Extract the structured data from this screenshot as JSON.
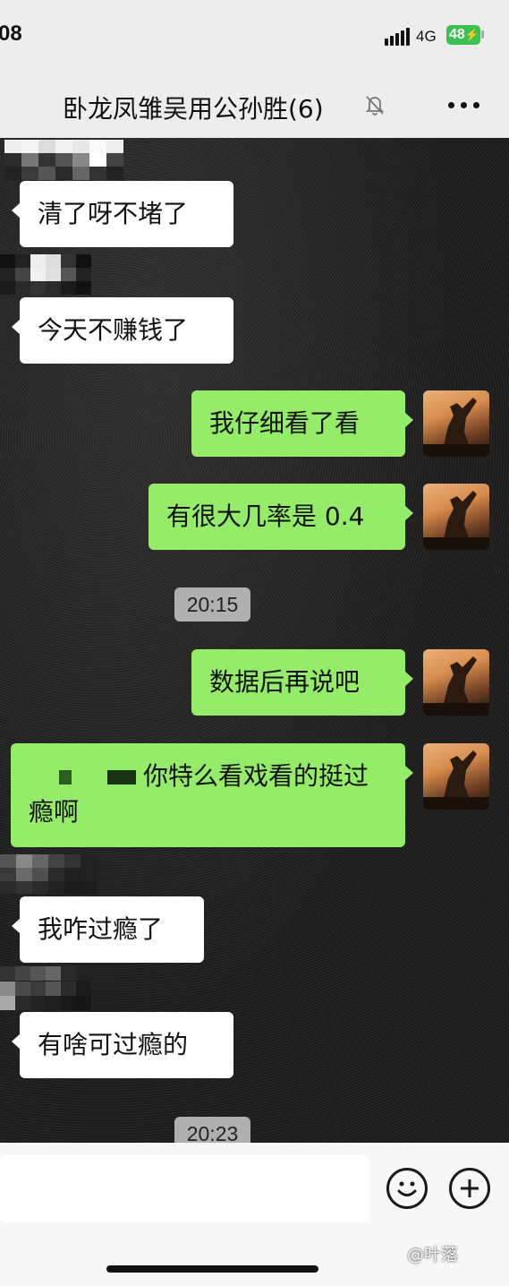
{
  "status_bar": {
    "time": "08",
    "network": "4G",
    "battery": "48"
  },
  "header": {
    "title": "卧龙凤雏吴用公孙胜(6)",
    "mute_icon": "bell-off-icon",
    "more_icon": "more-dots-icon"
  },
  "messages": [
    {
      "side": "left",
      "text": "清了呀不堵了"
    },
    {
      "side": "left",
      "text": "今天不赚钱了"
    },
    {
      "side": "right",
      "text": "我仔细看了看"
    },
    {
      "side": "right",
      "text": "有很大几率是 0.4"
    },
    {
      "type": "time",
      "text": "20:15"
    },
    {
      "side": "right",
      "text": "数据后再说吧"
    },
    {
      "side": "right",
      "text": "你特么看戏看的挺过瘾啊"
    },
    {
      "side": "left",
      "text": "我咋过瘾了"
    },
    {
      "side": "left",
      "text": "有啥可过瘾的"
    },
    {
      "type": "time",
      "text": "20:23"
    }
  ],
  "input_bar": {
    "emoji_icon": "emoji-icon",
    "plus_icon": "plus-circle-icon"
  },
  "watermark": "@叶落",
  "colors": {
    "bubble_self": "#95ec69",
    "bubble_other": "#ffffff",
    "battery": "#3cc150"
  }
}
